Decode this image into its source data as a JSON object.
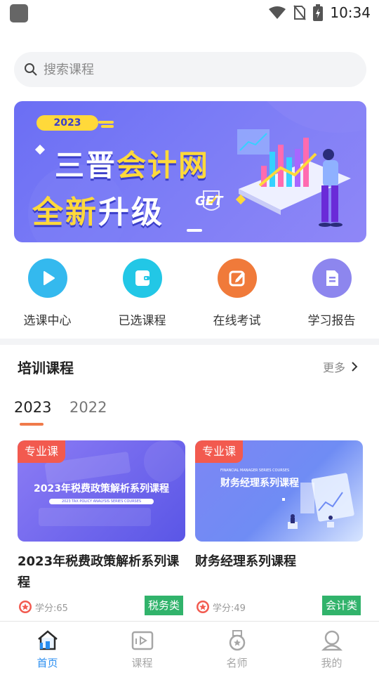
{
  "status_bar": {
    "time": "10:34"
  },
  "search": {
    "placeholder": "搜索课程"
  },
  "banner": {
    "year": "2023",
    "line1_a": "三晋",
    "line1_b": "会计网",
    "line2_a": "全新",
    "line2_b": "升级",
    "get": "GET"
  },
  "quick_actions": [
    {
      "label": "选课中心",
      "icon": "play-icon",
      "color": "#34b9ee"
    },
    {
      "label": "已选课程",
      "icon": "wallet-icon",
      "color": "#22c7e6"
    },
    {
      "label": "在线考试",
      "icon": "edit-icon",
      "color": "#f07a3a"
    },
    {
      "label": "学习报告",
      "icon": "report-icon",
      "color": "#8d86ee"
    }
  ],
  "training": {
    "title": "培训课程",
    "more": "更多",
    "years": [
      "2023",
      "2022"
    ],
    "courses": [
      {
        "tag": "专业课",
        "thumb_title": "2023年税费政策解析系列课程",
        "thumb_sub": "2023 TAX POLICY ANALYSIS SERIES COURSES",
        "title": "2023年税费政策解析系列课程",
        "credit": "学分:65",
        "category": "税务类"
      },
      {
        "tag": "专业课",
        "thumb_title": "财务经理系列课程",
        "thumb_sub": "FINANCIAL MANAGER SERIES COURSES",
        "title": "财务经理系列课程",
        "credit": "学分:49",
        "category": "会计类"
      }
    ]
  },
  "tabbar": [
    {
      "label": "首页",
      "active": true
    },
    {
      "label": "课程",
      "active": false
    },
    {
      "label": "名师",
      "active": false
    },
    {
      "label": "我的",
      "active": false
    }
  ],
  "colors": {
    "accent": "#2a8ef0",
    "tab_inactive": "#a6a6a6",
    "tag_red": "#f25a4f",
    "category_green": "#31b36b",
    "underline": "#f07a4a"
  }
}
